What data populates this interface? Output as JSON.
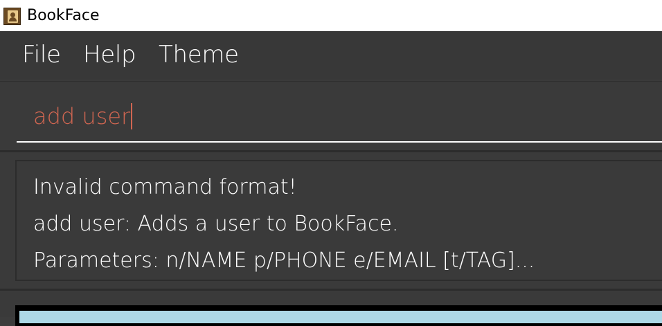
{
  "window": {
    "title": "BookFace",
    "icon": "address-book-icon"
  },
  "menu": {
    "items": [
      {
        "label": "File"
      },
      {
        "label": "Help"
      },
      {
        "label": "Theme"
      }
    ]
  },
  "command_box": {
    "value": "add user"
  },
  "result_display": {
    "lines": [
      "Invalid command format!",
      "add user: Adds a user to BookFace.",
      "Parameters: n/NAME p/PHONE e/EMAIL [t/TAG]..."
    ]
  },
  "colors": {
    "command_text": "#d06651",
    "background": "#3a3a3a",
    "list_panel": "#add8e6"
  }
}
